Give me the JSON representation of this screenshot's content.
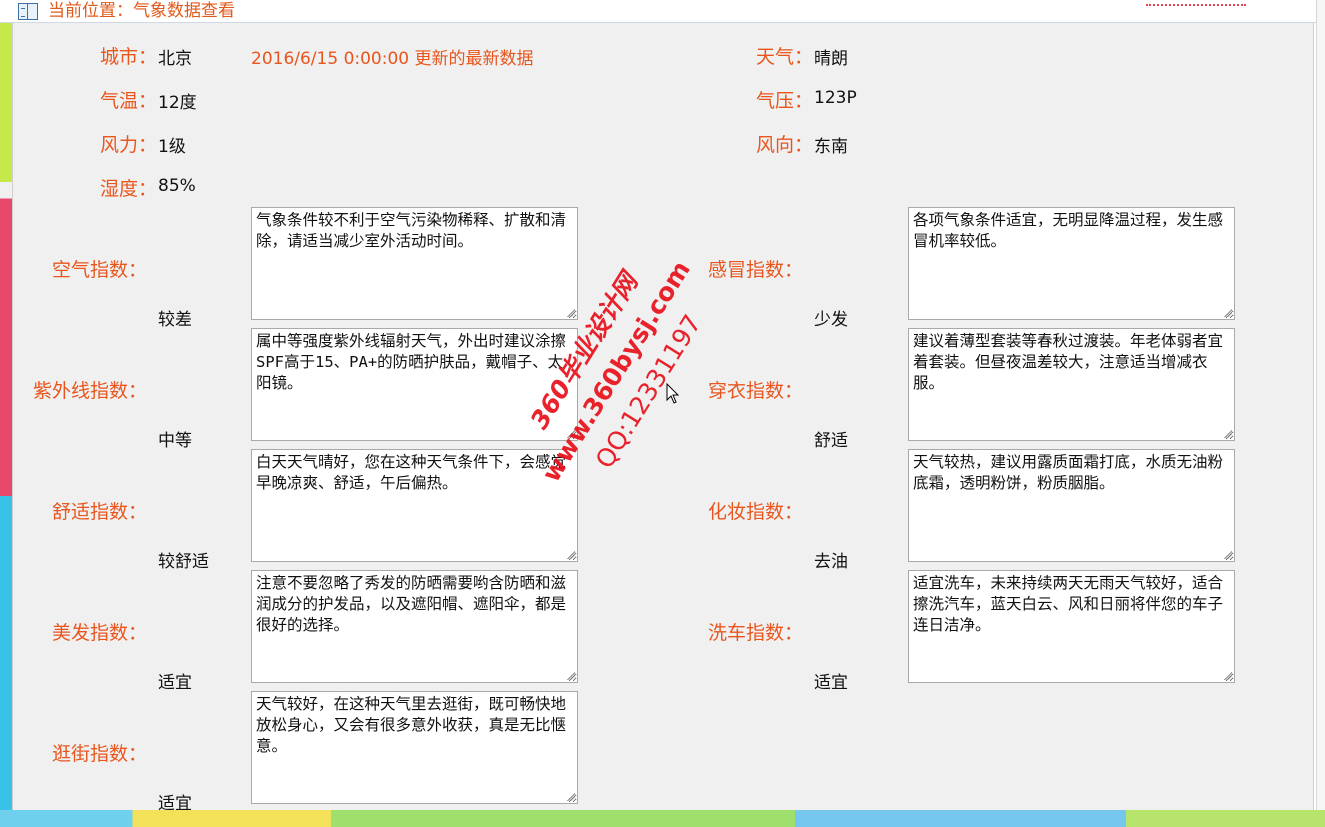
{
  "header": {
    "breadcrumb": "当前位置：气象数据查看"
  },
  "info": {
    "city_label": "城市：",
    "city_value": "北京",
    "update_text": "2016/6/15 0:00:00 更新的最新数据",
    "weather_label": "天气：",
    "weather_value": "晴朗",
    "temp_label": "气温：",
    "temp_value": "12度",
    "pressure_label": "气压：",
    "pressure_value": "123P",
    "wind_power_label": "风力：",
    "wind_power_value": "1级",
    "wind_dir_label": "风向：",
    "wind_dir_value": "东南",
    "humidity_label": "湿度：",
    "humidity_value": "85%"
  },
  "indices": {
    "left": [
      {
        "label": "空气指数：",
        "level": "较差",
        "desc": "气象条件较不利于空气污染物稀释、扩散和清除，请适当减少室外活动时间。"
      },
      {
        "label": "紫外线指数：",
        "level": "中等",
        "desc": "属中等强度紫外线辐射天气，外出时建议涂擦SPF高于15、PA+的防晒护肤品，戴帽子、太阳镜。"
      },
      {
        "label": "舒适指数：",
        "level": "较舒适",
        "desc": "白天天气晴好，您在这种天气条件下，会感觉早晚凉爽、舒适，午后偏热。"
      },
      {
        "label": "美发指数：",
        "level": "适宜",
        "desc": "注意不要忽略了秀发的防晒需要哟含防晒和滋润成分的护发品，以及遮阳帽、遮阳伞，都是很好的选择。"
      },
      {
        "label": "逛街指数：",
        "level": "适宜",
        "desc": "天气较好，在这种天气里去逛街，既可畅快地放松身心，又会有很多意外收获，真是无比惬意。"
      }
    ],
    "right": [
      {
        "label": "感冒指数：",
        "level": "少发",
        "desc": "各项气象条件适宜，无明显降温过程，发生感冒机率较低。"
      },
      {
        "label": "穿衣指数：",
        "level": "舒适",
        "desc": "建议着薄型套装等春秋过渡装。年老体弱者宜着套装。但昼夜温差较大，注意适当增减衣服。"
      },
      {
        "label": "化妆指数：",
        "level": "去油",
        "desc": "天气较热，建议用露质面霜打底，水质无油粉底霜，透明粉饼，粉质胭脂。"
      },
      {
        "label": "洗车指数：",
        "level": "适宜",
        "desc": "适宜洗车，未来持续两天无雨天气较好，适合擦洗汽车，蓝天白云、风和日丽将伴您的车子连日洁净。"
      }
    ]
  },
  "watermark": {
    "line1": "360毕业设计网",
    "line2": "www.360bysj.com",
    "line3": "QQ:12331197"
  },
  "colors": {
    "label": "#e8561e",
    "text": "#111111",
    "panel_bg": "#f0f0f0",
    "watermark": "#e8101a"
  }
}
